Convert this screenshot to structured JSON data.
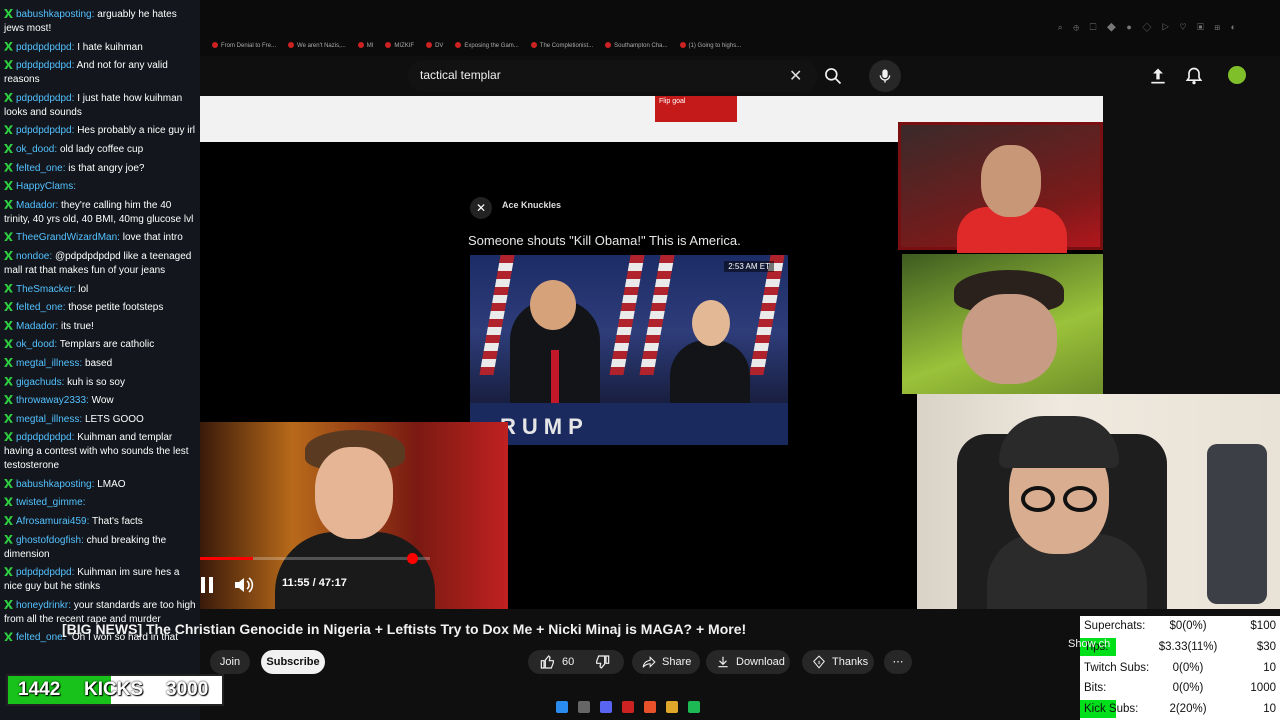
{
  "chat": {
    "messages": [
      {
        "user": "babushkaposting",
        "text": "arguably he hates jews most!"
      },
      {
        "user": "pdpdpdpdpd",
        "text": "I hate kuihman"
      },
      {
        "user": "pdpdpdpdpd",
        "text": "And not for any valid reasons"
      },
      {
        "user": "pdpdpdpdpd",
        "text": "I just hate how kuihman looks and sounds"
      },
      {
        "user": "pdpdpdpdpd",
        "text": "Hes probably a nice guy irl"
      },
      {
        "user": "ok_dood",
        "text": "old lady coffee cup"
      },
      {
        "user": "felted_one",
        "text": "is that angry joe?"
      },
      {
        "user": "HappyClams",
        "text": ""
      },
      {
        "user": "Madador",
        "text": "they're calling him the 40 trinity, 40 yrs old, 40 BMI, 40mg glucose lvl"
      },
      {
        "user": "TheeGrandWizardMan",
        "text": "love that intro"
      },
      {
        "user": "nondoe",
        "text": "@pdpdpdpdpd like a teenaged mall rat that makes fun of your jeans"
      },
      {
        "user": "TheSmacker",
        "text": "lol"
      },
      {
        "user": "felted_one",
        "text": "those petite footsteps"
      },
      {
        "user": "Madador",
        "text": "its true!"
      },
      {
        "user": "ok_dood",
        "text": "Templars are catholic"
      },
      {
        "user": "megtal_illness",
        "text": "based"
      },
      {
        "user": "gigachuds",
        "text": "kuh is so soy"
      },
      {
        "user": "throwaway2333",
        "text": "Wow"
      },
      {
        "user": "megtal_illness",
        "text": "LETS GOOO"
      },
      {
        "user": "pdpdpdpdpd",
        "text": "Kuihman and templar having a contest with who sounds the lest testosterone"
      },
      {
        "user": "babushkaposting",
        "text": "LMAO"
      },
      {
        "user": "twisted_gimme",
        "text": ""
      },
      {
        "user": "Afrosamurai459",
        "text": "That's facts"
      },
      {
        "user": "ghostofdogfish",
        "text": "chud breaking the dimension"
      },
      {
        "user": "pdpdpdpdpd",
        "text": "Kuihman im sure hes a nice guy but he stinks"
      },
      {
        "user": "honeydrinkr",
        "text": "your standards are too high from all the recent rape and murder"
      },
      {
        "user": "felted_one",
        "text": "\"Oh I won so hard in that"
      }
    ]
  },
  "kicks": {
    "current": "1442",
    "label": "KICKS",
    "goal": "3000",
    "progress": 0.48
  },
  "browser": {
    "bookmarks": [
      "From Denial to Fre...",
      "We aren't Nazis,...",
      "MI",
      "MIZKIF",
      "DV",
      "Exposing the Gam...",
      "The Completionist...",
      "Southampton Cha...",
      "(1) Going to highs..."
    ]
  },
  "youtube": {
    "search_value": "tactical templar",
    "video_title": "[BIG NEWS] The Christian Genocide in Nigeria + Leftists Try to Dox Me + Nicki Minaj is MAGA? + More!",
    "time": "11:55 / 47:17",
    "progress": 0.252,
    "join": "Join",
    "subscribe": "Subscribe",
    "likes": "60",
    "share": "Share",
    "download": "Download",
    "thanks": "Thanks",
    "show_chat": "Show ch",
    "more": "⋯"
  },
  "video_content": {
    "tweet_author": "Ace Knuckles",
    "tweet_text": "Someone shouts \"Kill Obama!\" This is America.",
    "image_timestamp": "2:53 AM ET",
    "podium_text": "RUMP",
    "red_tab_text": "Flip goal"
  },
  "stats": [
    {
      "label": "Superchats:",
      "value": "$0(0%)",
      "target": "$100",
      "fill": 0
    },
    {
      "label": "Tips:",
      "value": "$3.33(11%)",
      "target": "$30",
      "fill": 0.11
    },
    {
      "label": "Twitch Subs:",
      "value": "0(0%)",
      "target": "10",
      "fill": 0
    },
    {
      "label": "Bits:",
      "value": "0(0%)",
      "target": "1000",
      "fill": 0
    },
    {
      "label": "Kick Subs:",
      "value": "2(20%)",
      "target": "10",
      "fill": 0.2
    }
  ],
  "colors": {
    "accent_red": "#ff0000",
    "kick_green": "#18c21a",
    "stats_green": "#00e01a",
    "chat_user": "#53c1ff"
  }
}
